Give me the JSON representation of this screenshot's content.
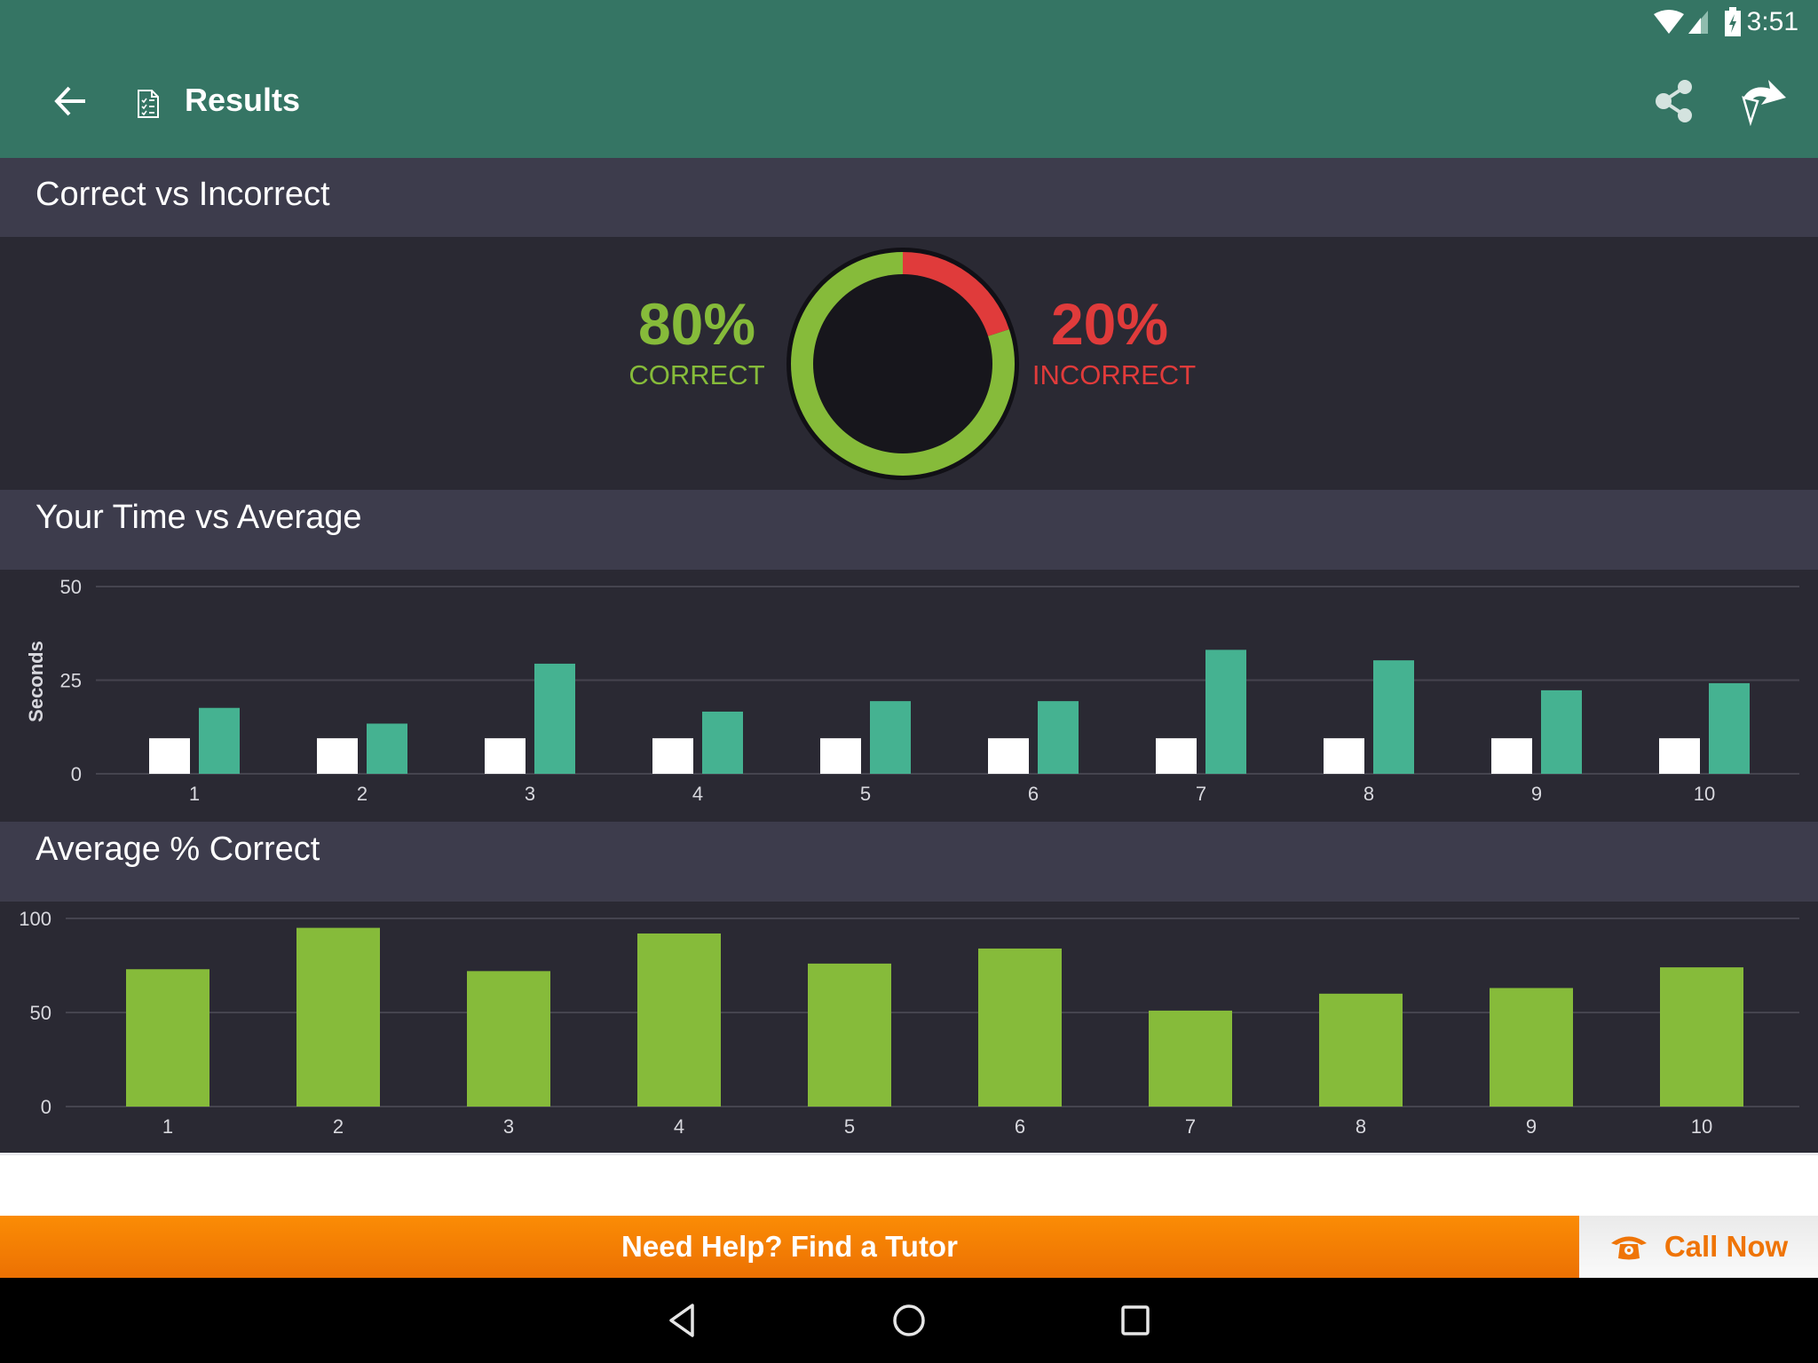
{
  "status_bar": {
    "time": "3:51",
    "icons": [
      "wifi-icon",
      "cellular-signal-icon",
      "battery-charging-icon"
    ]
  },
  "app_bar": {
    "title": "Results",
    "icons": {
      "back": "arrow-left-icon",
      "page": "checklist-document-icon",
      "share": "share-icon",
      "extra": "cheddar-forward-icon"
    }
  },
  "sections": {
    "correct_vs_incorrect": {
      "title": "Correct vs Incorrect",
      "correct_pct": "80%",
      "correct_label": "CORRECT",
      "incorrect_pct": "20%",
      "incorrect_label": "INCORRECT"
    },
    "time_vs_average": {
      "title": "Your Time vs Average"
    },
    "average_correct": {
      "title": "Average % Correct"
    }
  },
  "colors": {
    "app_bar": "#357564",
    "correct": "#86bb3a",
    "incorrect": "#e03b3b",
    "your_time": "#ffffff",
    "average_time": "#45b291",
    "avg_correct_bar": "#86bb3a",
    "tutor_banner": "#f7830a"
  },
  "chart_data": [
    {
      "type": "pie",
      "title": "Correct vs Incorrect",
      "categories": [
        "Correct",
        "Incorrect"
      ],
      "values": [
        80,
        20
      ],
      "style": "donut"
    },
    {
      "type": "bar",
      "title": "Your Time vs Average",
      "xlabel": "",
      "ylabel": "Seconds",
      "ylim": [
        0,
        50
      ],
      "yticks": [
        "0",
        "25",
        "50"
      ],
      "categories": [
        "1",
        "2",
        "3",
        "4",
        "5",
        "6",
        "7",
        "8",
        "9",
        "10"
      ],
      "series": [
        {
          "name": "Your Time",
          "values": [
            9.5,
            9.5,
            9.5,
            9.5,
            9.5,
            9.5,
            9.5,
            9.5,
            9.5,
            9.5
          ]
        },
        {
          "name": "Average",
          "values": [
            17.6,
            13.4,
            29.4,
            16.6,
            19.4,
            19.4,
            33.1,
            30.3,
            22.3,
            24.2
          ]
        }
      ],
      "grid": true
    },
    {
      "type": "bar",
      "title": "Average % Correct",
      "xlabel": "",
      "ylabel": "",
      "ylim": [
        0,
        100
      ],
      "yticks": [
        "0",
        "50",
        "100"
      ],
      "categories": [
        "1",
        "2",
        "3",
        "4",
        "5",
        "6",
        "7",
        "8",
        "9",
        "10"
      ],
      "values": [
        73,
        95,
        72,
        92,
        76,
        84,
        51,
        60,
        63,
        74
      ],
      "grid": true
    }
  ],
  "footer": {
    "tutor_banner": "Need Help? Find a Tutor",
    "call_now": "Call Now",
    "call_icon": "telephone-icon"
  },
  "nav_bar": {
    "buttons": [
      "back-triangle-icon",
      "home-circle-icon",
      "recents-square-icon"
    ]
  }
}
